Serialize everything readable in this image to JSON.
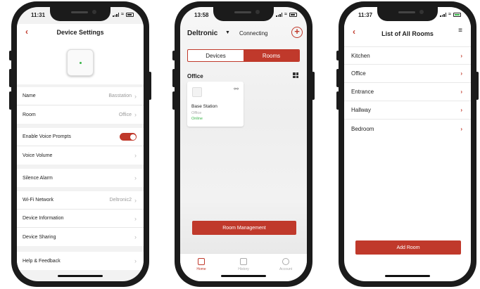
{
  "phone1": {
    "time": "11:31",
    "title": "Device Settings",
    "groups": [
      [
        {
          "label": "Name",
          "value": "Basstation"
        },
        {
          "label": "Room",
          "value": "Office"
        }
      ],
      [
        {
          "label": "Enable Voice Prompts",
          "toggle": true
        },
        {
          "label": "Voice Volume",
          "value": ""
        }
      ],
      [
        {
          "label": "Silence Alarm",
          "value": ""
        }
      ],
      [
        {
          "label": "Wi-Fi Network",
          "value": "Deltronic2"
        },
        {
          "label": "Device Information",
          "value": ""
        },
        {
          "label": "Device Sharing",
          "value": ""
        }
      ],
      [
        {
          "label": "Help & Feedback",
          "value": ""
        }
      ]
    ]
  },
  "phone2": {
    "time": "13:58",
    "brand": "Deltronic",
    "status": "Connecting",
    "tabs": [
      "Devices",
      "Rooms"
    ],
    "active_tab": "Rooms",
    "section": "Office",
    "device": {
      "name": "Base Station",
      "room": "Office",
      "state": "Online"
    },
    "room_button": "Room Management",
    "nav": [
      "Home",
      "History",
      "Account"
    ]
  },
  "phone3": {
    "time": "11:37",
    "title": "List of All Rooms",
    "rooms": [
      "Kitchen",
      "Office",
      "Entrance",
      "Hallway",
      "Bedroom"
    ],
    "add_button": "Add Room"
  },
  "colors": {
    "accent": "#c0392b",
    "online": "#3bb54a"
  }
}
